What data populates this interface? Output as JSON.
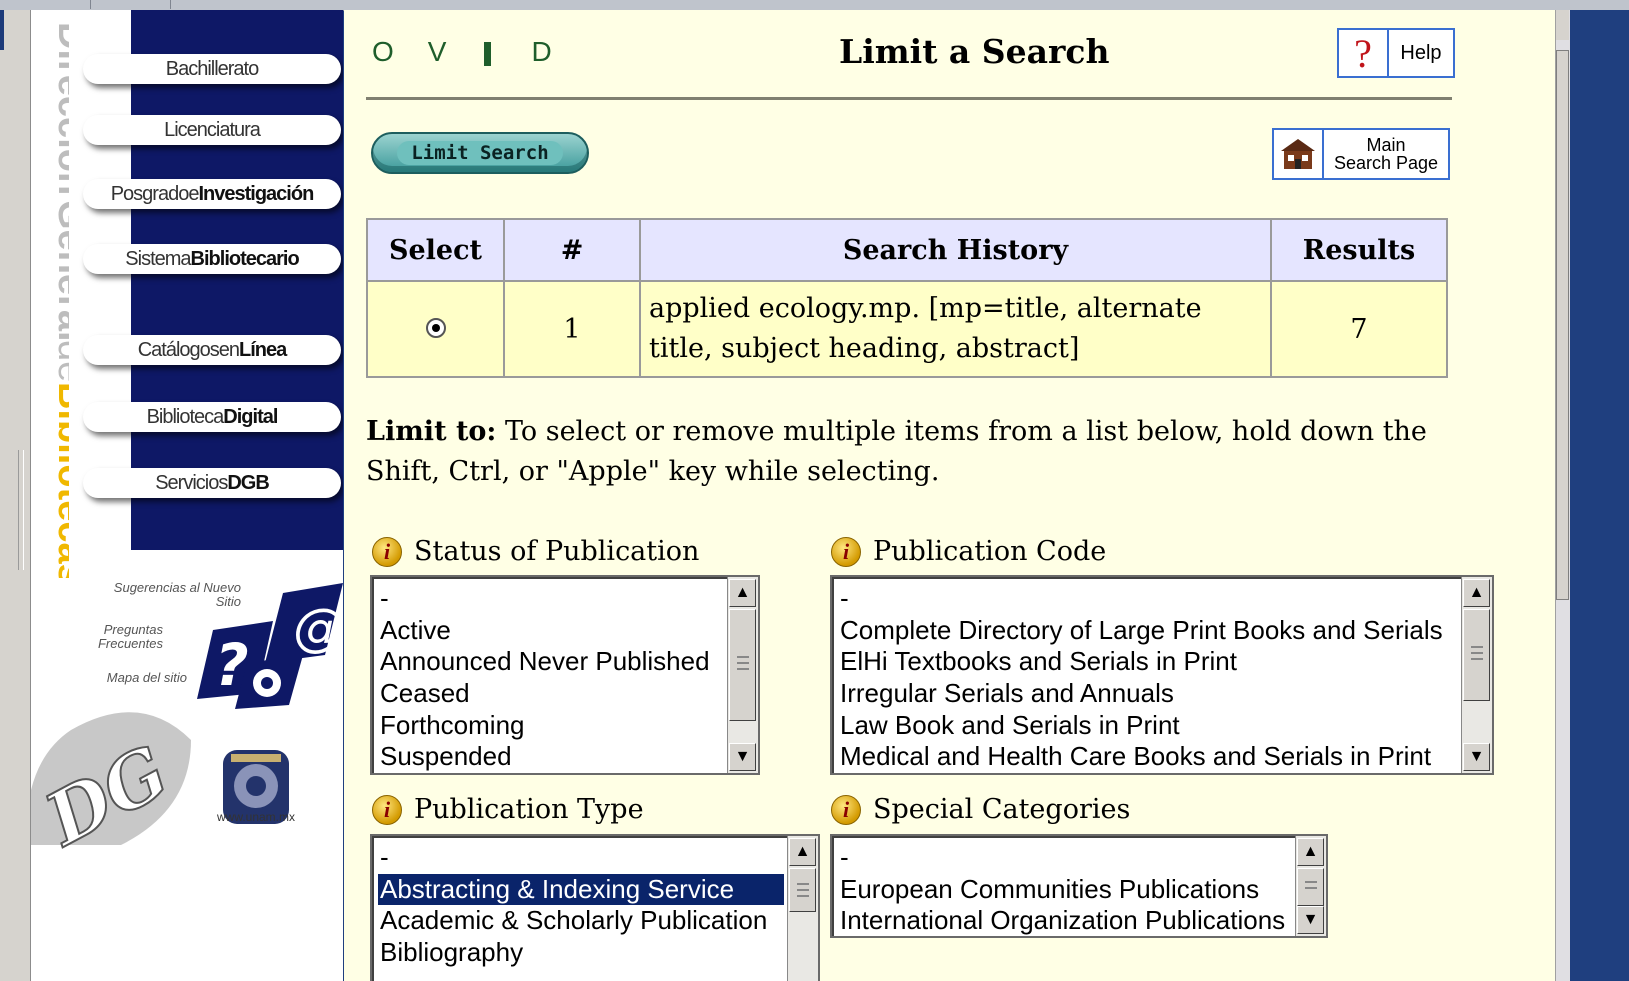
{
  "nav": {
    "vertical_title_parts": [
      "Dirección",
      "General",
      "de",
      "Bibliotecas"
    ],
    "buttons": [
      {
        "light": "Bachillerato",
        "bold": ""
      },
      {
        "light": "Licenciatura",
        "bold": ""
      },
      {
        "light": "Posgradoe",
        "bold": "Investigación"
      },
      {
        "light": "Sistema",
        "bold": "Bibliotecario"
      },
      {
        "light": "Catálogosen",
        "bold": "Línea"
      },
      {
        "light": "Biblioteca",
        "bold": "Digital"
      },
      {
        "light": "Servicios",
        "bold": "DGB"
      }
    ],
    "hints": {
      "sugerencias": "Sugerencias al Nuevo Sitio",
      "preguntas": "Preguntas Frecuentes",
      "mapa": "Mapa del sitio"
    },
    "unam_url": "www.unam.mx"
  },
  "header": {
    "ovid_letters": [
      "O",
      "V",
      "D"
    ],
    "title": "Limit a Search",
    "help_label": "Help",
    "help_glyph": "?"
  },
  "toolbar": {
    "limit_search_label": "Limit Search",
    "main_search_line1": "Main",
    "main_search_line2": "Search Page"
  },
  "history_table": {
    "headers": [
      "Select",
      "#",
      "Search History",
      "Results"
    ],
    "rows": [
      {
        "selected": true,
        "num": "1",
        "history": "applied ecology.mp. [mp=title, alternate title, subject heading, abstract]",
        "results": "7"
      }
    ]
  },
  "limit_to": {
    "label": "Limit to:",
    "text": " To select or remove multiple items from a list below, hold down the Shift, Ctrl, or \"Apple\" key while selecting."
  },
  "fields": {
    "status": {
      "label": "Status of Publication",
      "options": [
        "-",
        "Active",
        "Announced Never Published",
        "Ceased",
        "Forthcoming",
        "Suspended"
      ]
    },
    "pubcode": {
      "label": "Publication Code",
      "options": [
        "-",
        "Complete Directory of Large Print Books and Serials",
        "ElHi Textbooks and Serials in Print",
        "Irregular Serials and Annuals",
        "Law Book and Serials in Print",
        "Medical and Health Care Books and Serials in Print"
      ]
    },
    "pubtype": {
      "label": "Publication Type",
      "options": [
        "-",
        "Abstracting & Indexing Service",
        "Academic & Scholarly Publication",
        "Bibliography"
      ],
      "selected": "Abstracting & Indexing Service"
    },
    "special": {
      "label": "Special Categories",
      "options": [
        "-",
        "European Communities Publications",
        "International Organization Publications"
      ]
    }
  },
  "colors": {
    "page_bg": "#ffffe5",
    "header_cell": "#e5e5ff",
    "row_cell": "#ffffc8",
    "nav_blue": "#0e1866",
    "ovid_green": "#1f5e2b"
  }
}
